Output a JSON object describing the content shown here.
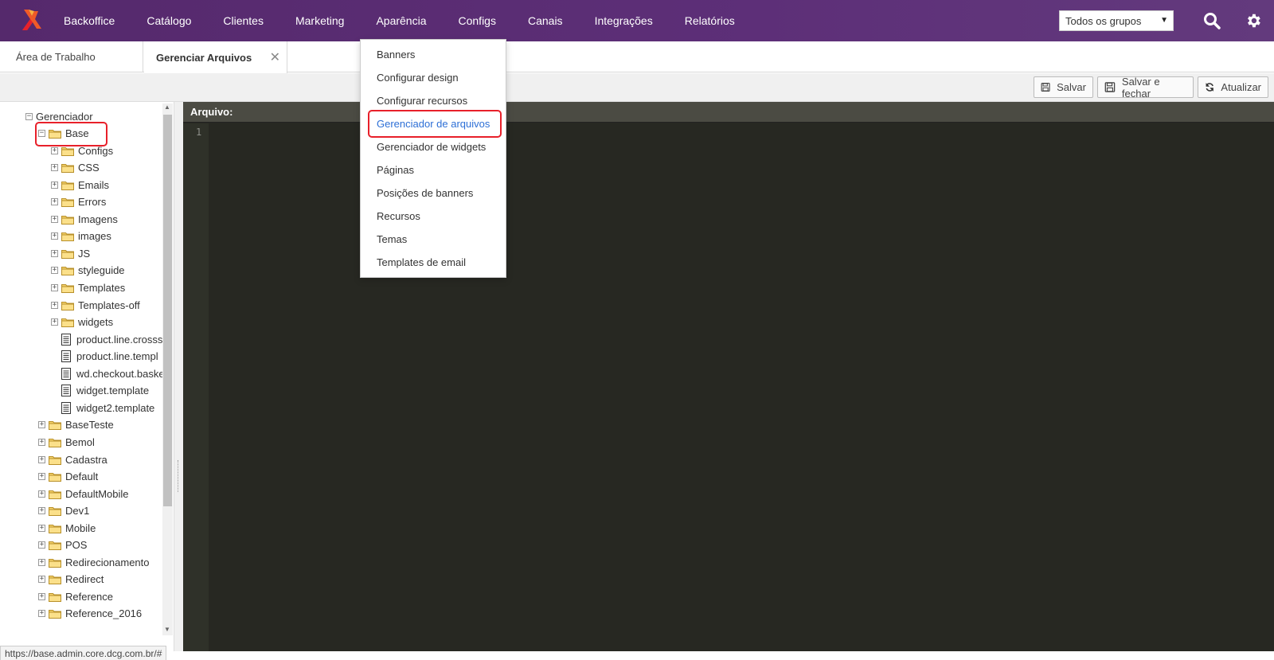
{
  "nav": {
    "items": [
      "Backoffice",
      "Catálogo",
      "Clientes",
      "Marketing",
      "Aparência",
      "Configs",
      "Canais",
      "Integrações",
      "Relatórios"
    ],
    "group_select": "Todos os grupos",
    "brand_color": "#5a2d74"
  },
  "tabs": {
    "tab1": "Área de Trabalho",
    "tab2": "Gerenciar Arquivos"
  },
  "toolbar": {
    "save": "Salvar",
    "save_close": "Salvar e fechar",
    "refresh": "Atualizar"
  },
  "tree": {
    "root": "Gerenciador",
    "base": "Base",
    "base_children": [
      "Configs",
      "CSS",
      "Emails",
      "Errors",
      "Imagens",
      "images",
      "JS",
      "styleguide",
      "Templates",
      "Templates-off",
      "widgets"
    ],
    "base_files": [
      "product.line.crosss",
      "product.line.templ",
      "wd.checkout.baske",
      "widget.template",
      "widget2.template"
    ],
    "other_folders": [
      "BaseTeste",
      "Bemol",
      "Cadastra",
      "Default",
      "DefaultMobile",
      "Dev1",
      "Mobile",
      "POS",
      "Redirecionamento",
      "Redirect",
      "Reference",
      "Reference_2016"
    ]
  },
  "editor": {
    "title": "Arquivo:",
    "line1": "1"
  },
  "dropdown": {
    "items": [
      "Banners",
      "Configurar design",
      "Configurar recursos",
      "Gerenciador de arquivos",
      "Gerenciador de widgets",
      "Páginas",
      "Posições de banners",
      "Recursos",
      "Temas",
      "Templates de email"
    ]
  },
  "status": {
    "url": "https://base.admin.core.dcg.com.br/#"
  }
}
